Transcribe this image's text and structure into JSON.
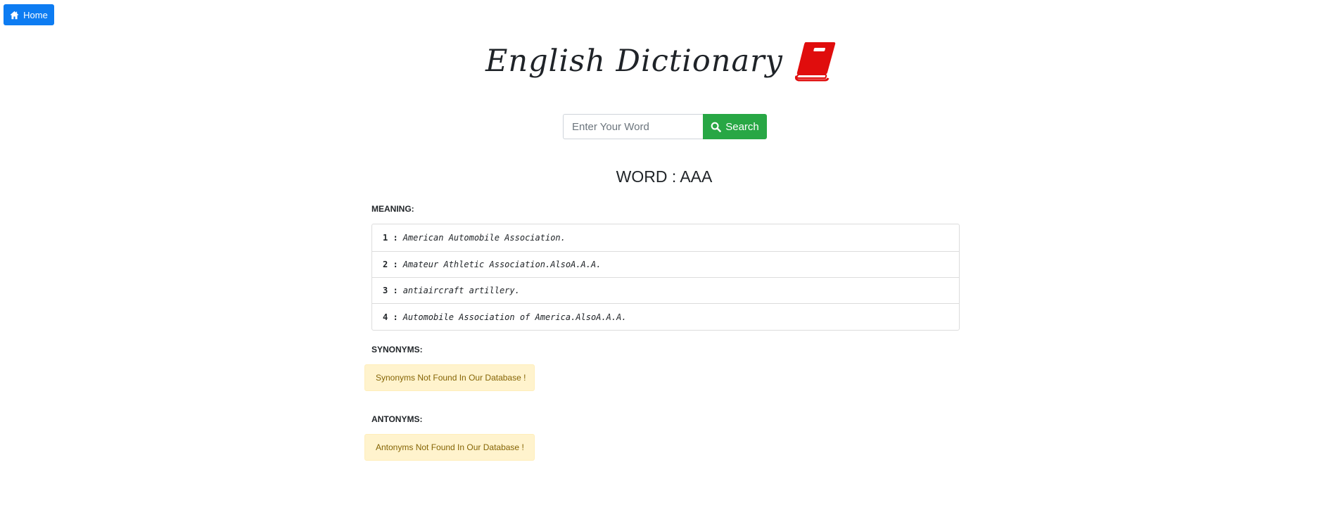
{
  "nav": {
    "home_label": "Home",
    "home_icon": "home-icon"
  },
  "header": {
    "title": "English Dictionary",
    "icon": "book-icon",
    "icon_color": "#e00d0d"
  },
  "search": {
    "placeholder": "Enter Your Word",
    "value": "",
    "button_label": "Search",
    "button_icon": "search-icon",
    "button_color": "#28a745"
  },
  "result": {
    "word_heading": "WORD : AAA",
    "meaning_label": "MEANING:",
    "meanings": [
      {
        "num": "1 :",
        "text": "American Automobile Association."
      },
      {
        "num": "2 :",
        "text": "Amateur Athletic Association.AlsoA.A.A."
      },
      {
        "num": "3 :",
        "text": "antiaircraft artillery."
      },
      {
        "num": "4 :",
        "text": "Automobile Association of America.AlsoA.A.A."
      }
    ],
    "synonyms_label": "SYNONYMS:",
    "synonyms_message": "Synonyms Not Found In Our Database !",
    "antonyms_label": "ANTONYMS:",
    "antonyms_message": "Antonyms Not Found In Our Database !"
  },
  "colors": {
    "home_button": "#0d7cf2",
    "alert_bg": "#fff3cd",
    "alert_text": "#856404"
  }
}
